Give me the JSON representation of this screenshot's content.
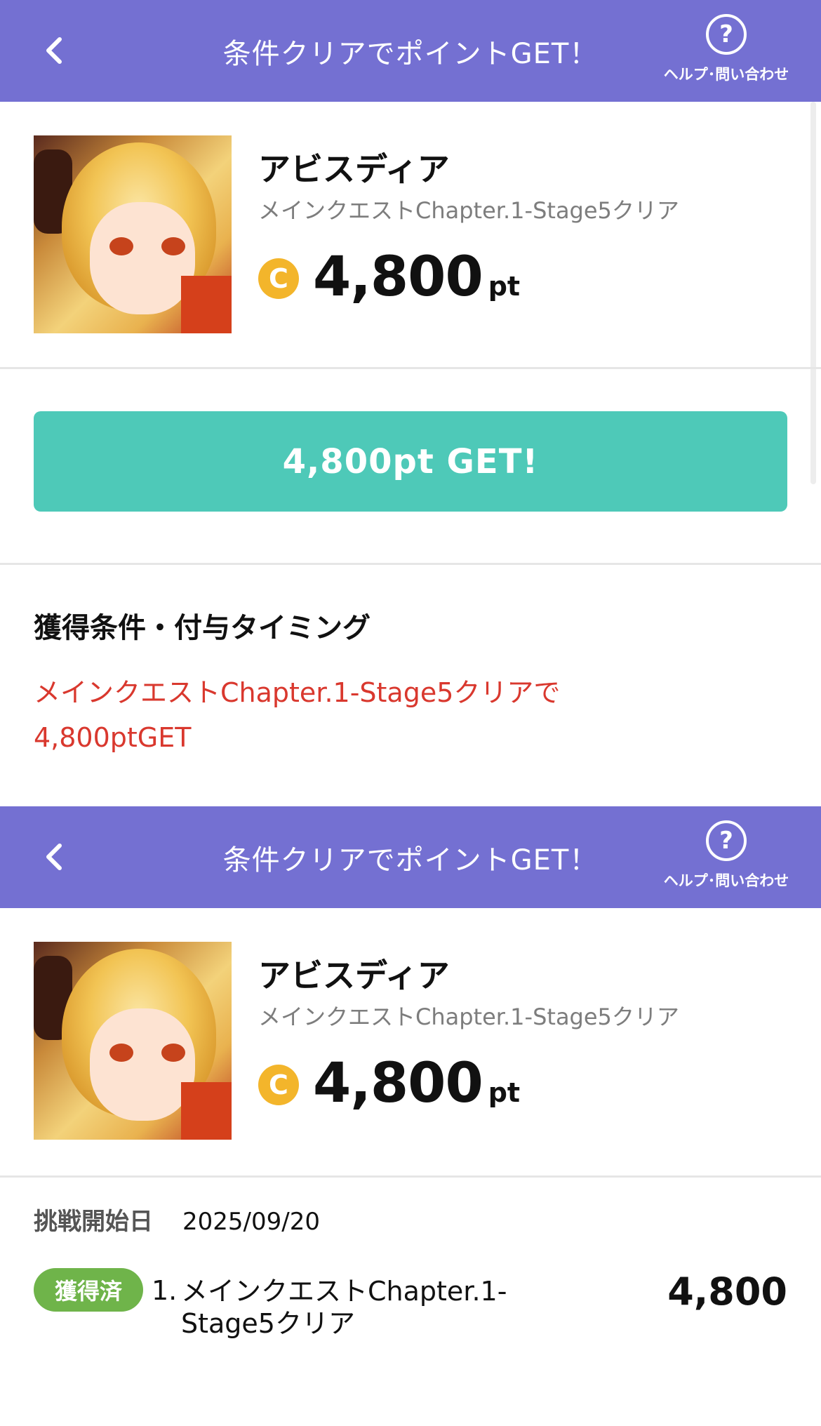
{
  "screen1": {
    "header": {
      "title": "条件クリアでポイントGET！",
      "help_label": "ヘルプ･問い合わせ",
      "help_icon_glyph": "?",
      "back_icon": "chevron-left-icon"
    },
    "offer": {
      "app_name": "アビスディア",
      "condition": "メインクエストChapter.1-Stage5クリア",
      "coin_glyph": "C",
      "points": "4,800",
      "unit": "pt"
    },
    "get_button_label": "4,800pt GET!",
    "section_title": "獲得条件・付与タイミング",
    "condition_text": "メインクエストChapter.1-Stage5クリアで4,800ptGET"
  },
  "screen2": {
    "header": {
      "title": "条件クリアでポイントGET！",
      "help_label": "ヘルプ･問い合わせ",
      "help_icon_glyph": "?",
      "back_icon": "chevron-left-icon"
    },
    "offer": {
      "app_name": "アビスディア",
      "condition": "メインクエストChapter.1-Stage5クリア",
      "coin_glyph": "C",
      "points": "4,800",
      "unit": "pt"
    },
    "start_label": "挑戦開始日",
    "start_date": "2025/09/20",
    "steps": [
      {
        "badge": "獲得済",
        "number": "1.",
        "text": "メインクエストChapter.1-Stage5クリア",
        "points": "4,800"
      }
    ]
  },
  "colors": {
    "header_bg": "#7470d2",
    "button_bg": "#4ec9b8",
    "condition_red": "#d9382e",
    "coin": "#f3b52b",
    "badge_green": "#6fb44a"
  }
}
